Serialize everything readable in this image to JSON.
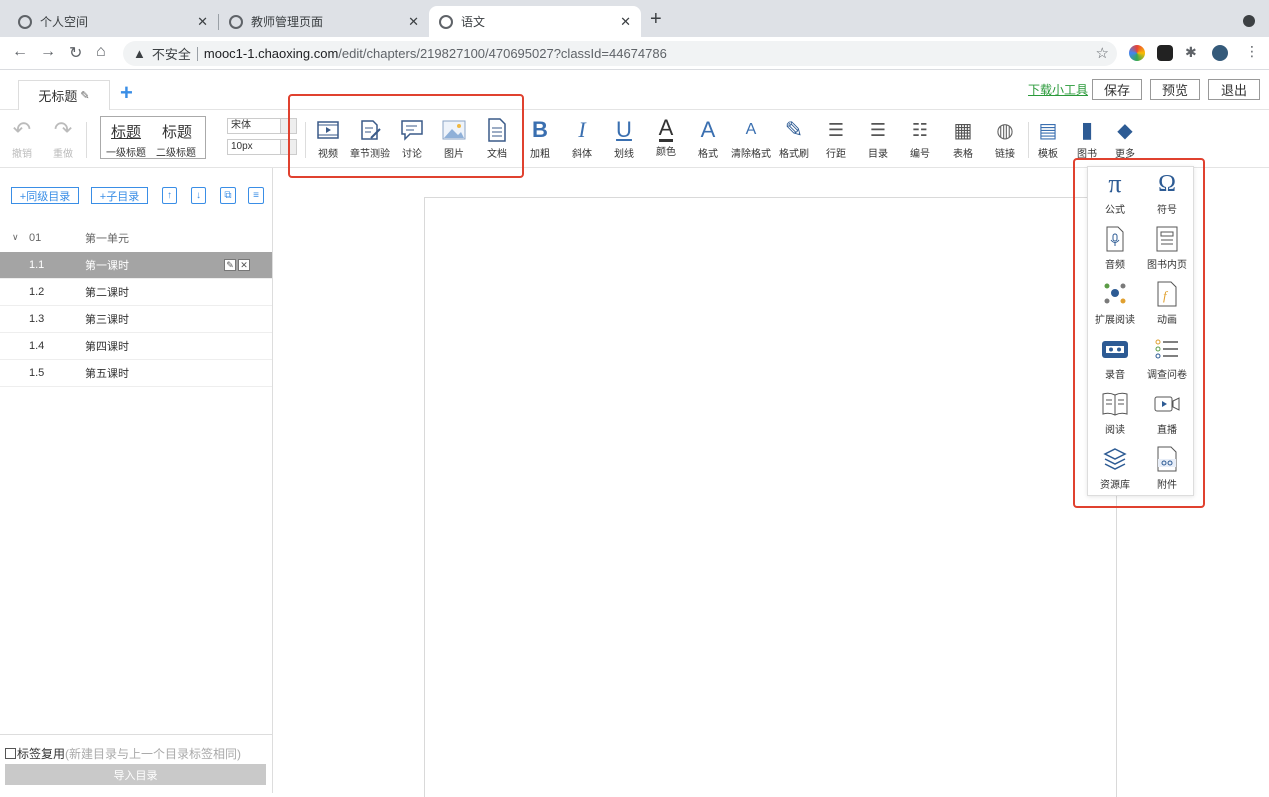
{
  "browser": {
    "tabs": [
      {
        "title": "个人空间"
      },
      {
        "title": "教师管理页面"
      },
      {
        "title": "语文"
      }
    ],
    "address": {
      "security": "不安全",
      "host": "mooc1-1.chaoxing.com",
      "path": "/edit/chapters/219827100/470695027?classId=44674786"
    }
  },
  "editor_header": {
    "doc_tab": "无标题",
    "download_link": "下载小工具",
    "save": "保存",
    "preview": "预览",
    "exit": "退出"
  },
  "toolbar": {
    "undo": "撤销",
    "redo": "重做",
    "heading1_big": "标题",
    "heading2_big": "标题",
    "heading1_small": "一级标题",
    "heading2_small": "二级标题",
    "font_family": "宋体",
    "font_size": "10px",
    "insert_tools": [
      {
        "label": "视频",
        "icon": "video-icon"
      },
      {
        "label": "章节测验",
        "icon": "quiz-icon"
      },
      {
        "label": "讨论",
        "icon": "discussion-icon"
      },
      {
        "label": "图片",
        "icon": "image-icon"
      },
      {
        "label": "文档",
        "icon": "document-icon"
      }
    ],
    "format_tools": [
      {
        "label": "加粗",
        "glyph": "B"
      },
      {
        "label": "斜体",
        "glyph": "I"
      },
      {
        "label": "划线",
        "glyph": "U"
      },
      {
        "label": "颜色",
        "glyph": "A"
      },
      {
        "label": "格式",
        "glyph": "A"
      },
      {
        "label": "清除格式",
        "glyph": "A"
      },
      {
        "label": "格式刷",
        "glyph": "✎"
      },
      {
        "label": "行距",
        "glyph": "☰"
      },
      {
        "label": "目录",
        "glyph": "☰"
      },
      {
        "label": "编号",
        "glyph": "☷"
      },
      {
        "label": "表格",
        "glyph": "▦"
      },
      {
        "label": "链接",
        "glyph": "◍"
      },
      {
        "label": "模板",
        "glyph": "▤"
      },
      {
        "label": "图书",
        "glyph": "▮"
      },
      {
        "label": "更多",
        "glyph": "◆"
      }
    ]
  },
  "sidebar": {
    "add_sibling": "+同级目录",
    "add_child": "+子目录",
    "unit": {
      "num": "01",
      "title": "第一单元"
    },
    "lessons": [
      {
        "num": "1.1",
        "title": "第一课时"
      },
      {
        "num": "1.2",
        "title": "第二课时"
      },
      {
        "num": "1.3",
        "title": "第三课时"
      },
      {
        "num": "1.4",
        "title": "第四课时"
      },
      {
        "num": "1.5",
        "title": "第五课时"
      }
    ],
    "reuse_label": "标签复用",
    "reuse_hint": "(新建目录与上一个目录标签相同)",
    "import_button": "导入目录"
  },
  "more_panel": {
    "items": [
      {
        "label": "公式",
        "icon": "pi-icon"
      },
      {
        "label": "符号",
        "icon": "omega-icon"
      },
      {
        "label": "音频",
        "icon": "audio-icon"
      },
      {
        "label": "图书内页",
        "icon": "book-page-icon"
      },
      {
        "label": "扩展阅读",
        "icon": "extended-reading-icon"
      },
      {
        "label": "动画",
        "icon": "animation-icon"
      },
      {
        "label": "录音",
        "icon": "recording-icon"
      },
      {
        "label": "调查问卷",
        "icon": "survey-icon"
      },
      {
        "label": "阅读",
        "icon": "reading-icon"
      },
      {
        "label": "直播",
        "icon": "live-icon"
      },
      {
        "label": "资源库",
        "icon": "resource-library-icon"
      },
      {
        "label": "附件",
        "icon": "attachment-icon"
      }
    ]
  },
  "colors": {
    "accent": "#3a8ee6",
    "highlight": "#e0412f",
    "selected_row": "#a4a4a4",
    "icon_blue": "#2d5b94"
  }
}
